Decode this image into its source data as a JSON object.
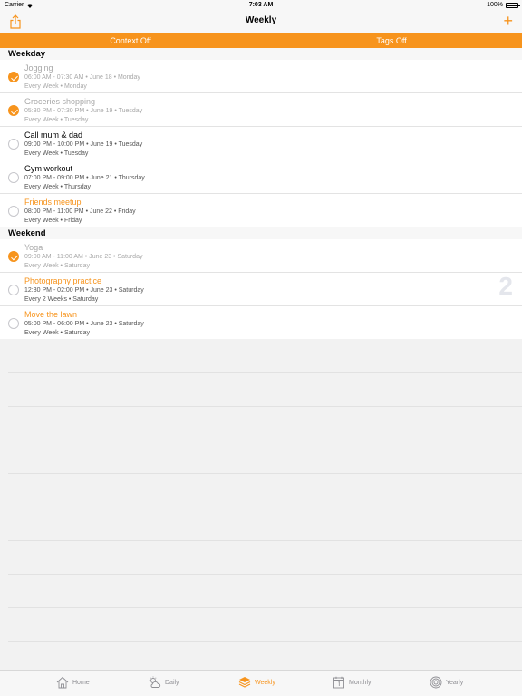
{
  "status": {
    "carrier": "Carrier",
    "time": "7:03 AM",
    "battery": "100%"
  },
  "nav": {
    "title": "Weekly",
    "add_label": "+"
  },
  "filters": {
    "context": "Context Off",
    "tags": "Tags Off"
  },
  "sections": [
    {
      "header": "Weekday",
      "items": [
        {
          "title": "Jogging",
          "time": "06:00 AM - 07:30 AM • June 18 • Monday",
          "repeat": "Every Week • Monday",
          "done": true,
          "accent": false
        },
        {
          "title": "Groceries shopping",
          "time": "05:30 PM - 07:30 PM • June 19 • Tuesday",
          "repeat": "Every Week • Tuesday",
          "done": true,
          "accent": false
        },
        {
          "title": "Call mum & dad",
          "time": "09:00 PM - 10:00 PM • June 19 • Tuesday",
          "repeat": "Every Week • Tuesday",
          "done": false,
          "accent": false
        },
        {
          "title": "Gym workout",
          "time": "07:00 PM - 09:00 PM • June 21 • Thursday",
          "repeat": "Every Week • Thursday",
          "done": false,
          "accent": false
        },
        {
          "title": "Friends meetup",
          "time": "08:00 PM - 11:00 PM • June 22 • Friday",
          "repeat": "Every Week • Friday",
          "done": false,
          "accent": true
        }
      ]
    },
    {
      "header": "Weekend",
      "items": [
        {
          "title": "Yoga",
          "time": "09:00 AM - 11:00 AM • June 23 • Saturday",
          "repeat": "Every Week • Saturday",
          "done": true,
          "accent": false
        },
        {
          "title": "Photography practice",
          "time": "12:30 PM - 02:00 PM • June 23 • Saturday",
          "repeat": "Every 2 Weeks • Saturday",
          "done": false,
          "accent": true
        },
        {
          "title": "Move the lawn",
          "time": "05:00 PM - 06:00 PM • June 23 • Saturday",
          "repeat": "Every Week • Saturday",
          "done": false,
          "accent": true
        }
      ]
    }
  ],
  "week_badge": "2",
  "tabs": [
    {
      "label": "Home",
      "icon": "house-icon",
      "active": false
    },
    {
      "label": "Daily",
      "icon": "sun-cloud-icon",
      "active": false
    },
    {
      "label": "Weekly",
      "icon": "layers-icon",
      "active": true
    },
    {
      "label": "Monthly",
      "icon": "calendar-icon",
      "active": false
    },
    {
      "label": "Yearly",
      "icon": "target-icon",
      "active": false
    }
  ],
  "colors": {
    "accent": "#f7941d",
    "completed_text": "#a8a8a8",
    "badge": "#e4e6ec"
  }
}
